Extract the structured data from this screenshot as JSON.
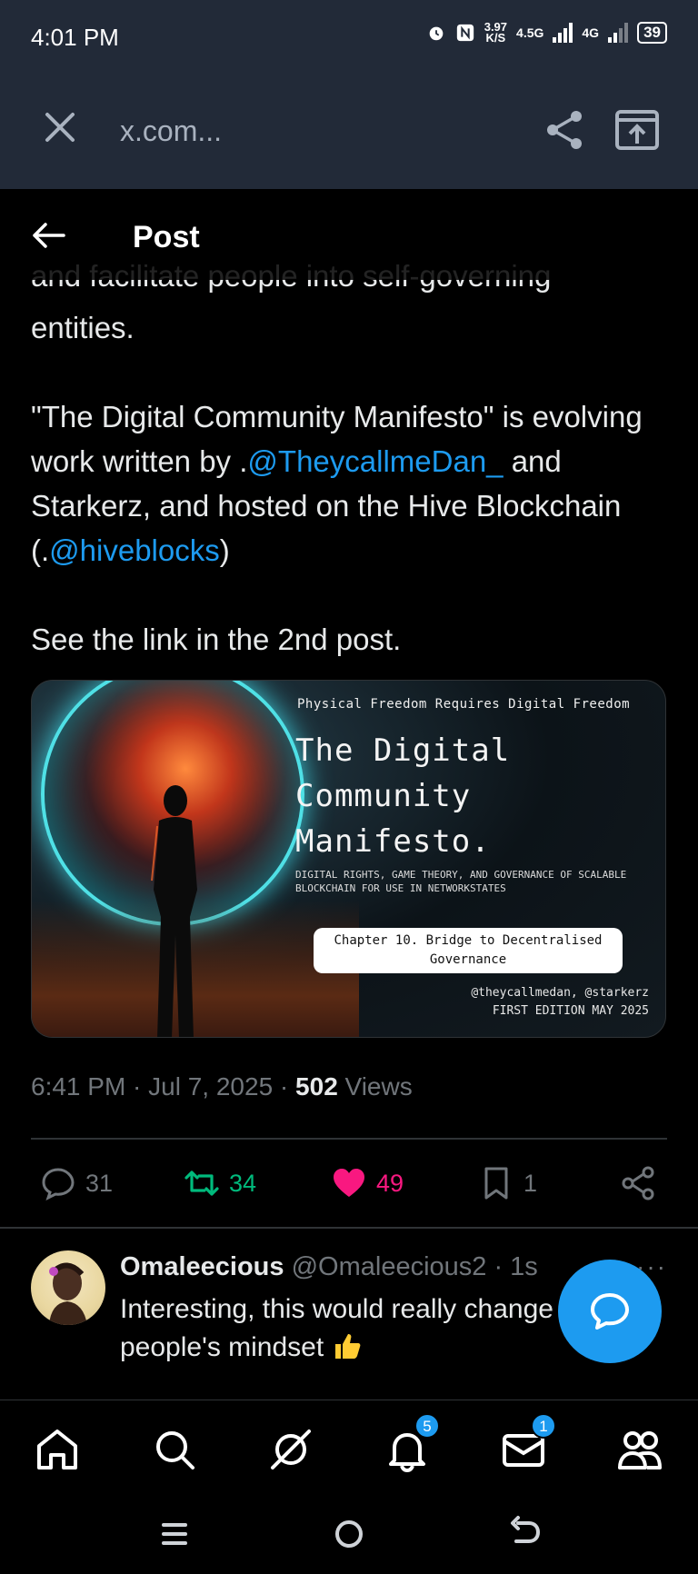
{
  "status_bar": {
    "time": "4:01 PM",
    "speed_value": "3.97",
    "speed_unit": "K/S",
    "network_1": "4.5G",
    "network_2": "4G",
    "battery": "39"
  },
  "browser": {
    "url": "x.com..."
  },
  "header": {
    "title": "Post"
  },
  "post": {
    "cut_line": "and facilitate people into self-governing",
    "line_entities": "entities.",
    "para2_part1": "\"The Digital Community Manifesto\" is evolving work written by .",
    "mention_1": "@TheycallmeDan_",
    "para2_part2": " and Starkerz, and hosted on the Hive Blockchain (.",
    "mention_2": "@hiveblocks",
    "para2_part3": ")",
    "para3": "See the link in the 2nd post.",
    "timestamp": "6:41 PM · Jul 7, 2025 · ",
    "views_count": "502",
    "views_label": " Views"
  },
  "media": {
    "tagline": "Physical Freedom Requires Digital Freedom",
    "title_line1": "The Digital",
    "title_line2": "Community",
    "title_line3": "Manifesto.",
    "subtitle": "DIGITAL RIGHTS, GAME THEORY, AND GOVERNANCE OF SCALABLE BLOCKCHAIN FOR USE IN NETWORKSTATES",
    "chapter": "Chapter 10. Bridge to Decentralised Governance",
    "authors": "@theycallmedan, @starkerz",
    "edition": "FIRST EDITION MAY 2025"
  },
  "actions": {
    "replies": "31",
    "reposts": "34",
    "likes": "49",
    "bookmarks": "1"
  },
  "reply": {
    "name": "Omaleecious",
    "handle": " @Omaleecious2 · 1s",
    "text": "Interesting, this would really change people's mindset",
    "more": "···"
  },
  "nav": {
    "notifications_badge": "5",
    "messages_badge": "1"
  },
  "colors": {
    "accent": "#1d9bf0",
    "repost": "#00ba7c",
    "like": "#f91880",
    "muted": "#71767b",
    "chrome": "#222a38"
  }
}
